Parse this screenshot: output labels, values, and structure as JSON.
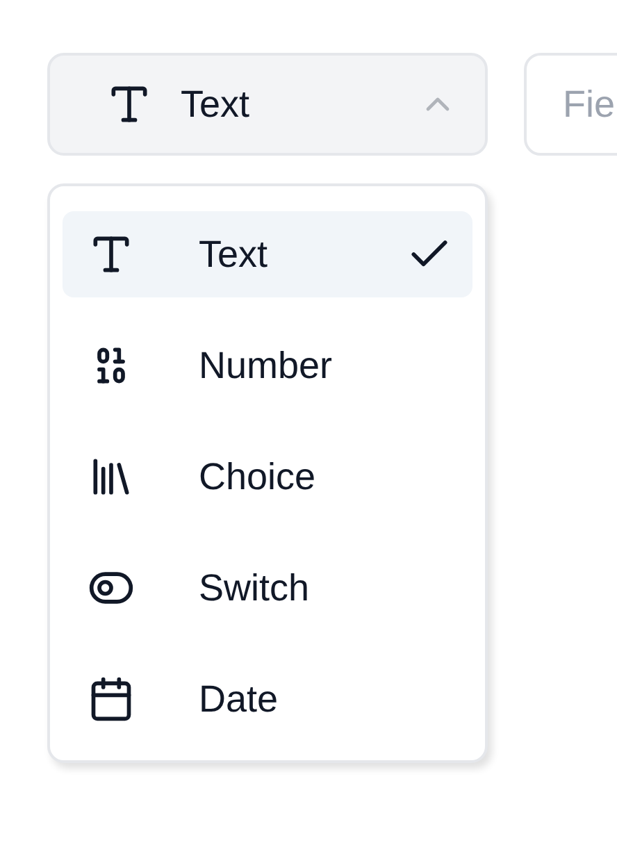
{
  "type_select": {
    "kind": "text",
    "value": "Text",
    "expanded": true
  },
  "field_name": {
    "placeholder": "Fie"
  },
  "menu": {
    "items": [
      {
        "kind": "text",
        "label": "Text",
        "selected": true
      },
      {
        "kind": "number",
        "label": "Number",
        "selected": false
      },
      {
        "kind": "choice",
        "label": "Choice",
        "selected": false
      },
      {
        "kind": "switch",
        "label": "Switch",
        "selected": false
      },
      {
        "kind": "date",
        "label": "Date",
        "selected": false
      }
    ]
  }
}
